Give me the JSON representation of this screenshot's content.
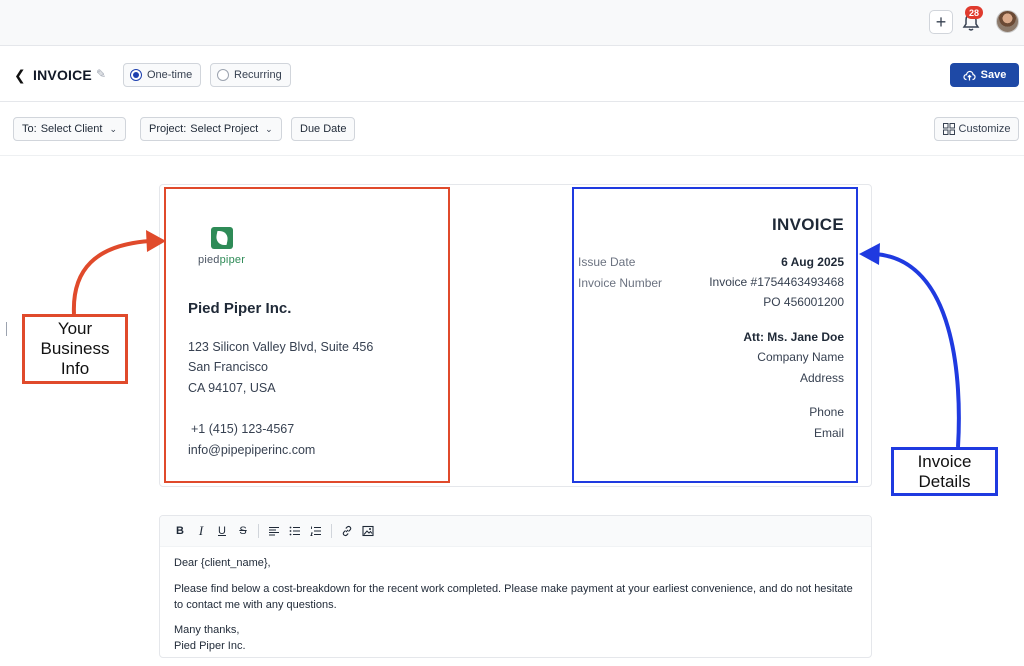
{
  "header": {
    "plus_icon": "plus-icon",
    "notification_count": "28",
    "bell_icon": "bell-icon"
  },
  "toolbar": {
    "back_icon": "chevron-left-icon",
    "title": "INVOICE",
    "one_time_label": "One-time",
    "recurring_label": "Recurring",
    "selected_frequency": "One-time",
    "save_label": "Save",
    "save_icon": "cloud-upload-icon"
  },
  "filters": {
    "to_prefix": "To:",
    "to_value": "Select Client",
    "project_prefix": "Project:",
    "project_value": "Select Project",
    "due_date_label": "Due Date",
    "customize_label": "Customize"
  },
  "business": {
    "logo_text_a": "pied",
    "logo_text_b": "piper",
    "name": "Pied Piper Inc.",
    "address_line1": "123 Silicon Valley Blvd, Suite 456",
    "address_line2": "San Francisco",
    "address_line3": "CA 94107, USA",
    "phone": "+1 (415) 123-4567",
    "email": "info@pipepiperinc.com"
  },
  "invoice_details": {
    "heading": "INVOICE",
    "issue_date_label": "Issue Date",
    "issue_date_value": "6 Aug 2025",
    "invoice_number_label": "Invoice Number",
    "invoice_number_value": "Invoice #1754463493468",
    "po_value": "PO 456001200",
    "attention": "Att: Ms. Jane Doe",
    "company_name": "Company Name",
    "address": "Address",
    "phone": "Phone",
    "email": "Email"
  },
  "annotations": {
    "business_callout": "Your Business Info",
    "details_callout": "Invoice Details",
    "red_color": "#e04a2b",
    "blue_color": "#1f3ae0"
  },
  "editor": {
    "toolbar_buttons": [
      "B",
      "I",
      "U",
      "S"
    ],
    "greeting": "Dear {client_name},",
    "body": "Please find below a cost-breakdown for the recent work completed. Please make payment at your earliest convenience, and do not hesitate to contact me with any questions.",
    "signoff": "Many thanks,",
    "signature": "Pied Piper Inc."
  },
  "colors": {
    "primary": "#1e49a6",
    "brand_green": "#2e8b57",
    "badge_red": "#e03b2e"
  }
}
